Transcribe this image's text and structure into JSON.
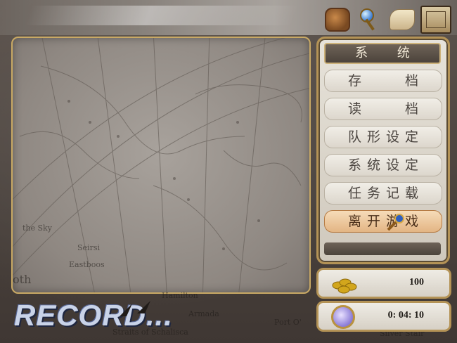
{
  "header": {
    "icons": [
      "bag-icon",
      "wand-icon",
      "scroll-icon",
      "book-icon"
    ]
  },
  "map": {
    "labels": [
      "the Sky",
      "Seirsi",
      "Eastboos",
      "oth",
      "Hamilton",
      "Armada",
      "Straits of Schalisca",
      "Port O'",
      "Silver Stair"
    ]
  },
  "record": {
    "label": "RECORD..."
  },
  "menu": {
    "title": "系 统",
    "items": [
      {
        "label": "存  档",
        "style": "spaced"
      },
      {
        "label": "读  档",
        "style": "spaced"
      },
      {
        "label": "队形设定",
        "style": "wide"
      },
      {
        "label": "系统设定",
        "style": "wide"
      },
      {
        "label": "任务记载",
        "style": "wide"
      },
      {
        "label": "离开游戏",
        "style": "wide",
        "active": true
      }
    ]
  },
  "status": {
    "gold": "100",
    "time": "0: 04: 10"
  },
  "colors": {
    "panel_border": "#b49356",
    "active_item": "#e3b584",
    "record_text": "#c9d3e8"
  }
}
